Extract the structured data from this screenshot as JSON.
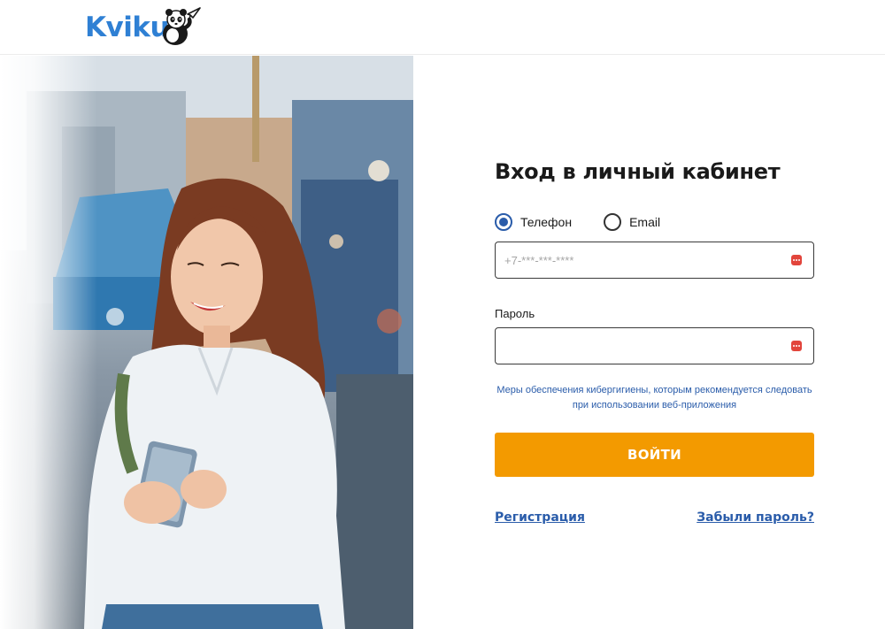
{
  "brand": {
    "logo_text": "Kviku",
    "logo_color": "#2f80d4"
  },
  "form": {
    "title": "Вход в личный кабинет",
    "login_type": {
      "options": [
        {
          "label": "Телефон",
          "selected": true
        },
        {
          "label": "Email",
          "selected": false
        }
      ]
    },
    "phone_field": {
      "placeholder": "+7-***-***-****",
      "value": ""
    },
    "password_field": {
      "label": "Пароль",
      "value": ""
    },
    "hygiene_link": "Меры обеспечения кибергигиены, которым рекомендуется следовать при использовании веб-приложения",
    "submit_label": "ВОЙТИ",
    "register_link": "Регистрация",
    "forgot_link": "Забыли пароль?"
  },
  "icons": {
    "field_icon": "password-manager-icon"
  },
  "colors": {
    "accent": "#2a5caa",
    "button": "#f39a00",
    "field_icon": "#e2453c"
  }
}
